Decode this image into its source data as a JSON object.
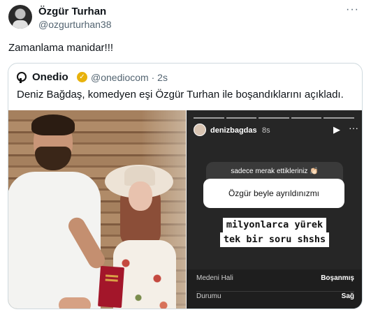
{
  "post": {
    "author_name": "Özgür Turhan",
    "author_handle": "@ozgurturhan38",
    "more_icon": "more-horizontal-icon",
    "text": "Zamanlama manidar!!!"
  },
  "quote": {
    "author_name": "Onedio",
    "author_handle": "@onediocom",
    "time": "2s",
    "verified_color": "#e8b20c",
    "text": "Deniz Bağdaş, komedyen eşi Özgür Turhan ile boşandıklarını açıkladı."
  },
  "story": {
    "username": "denizbagdas",
    "time": "8s",
    "question_prompt": "sadece merak ettikleriniz 👏🏻",
    "question": "Özgür beyle ayrıldınızmı",
    "overlay_line1": "milyonlarca yürek",
    "overlay_line2": "tek bir soru shshs",
    "info": [
      {
        "label": "Medeni Hali",
        "value": "Boşanmış"
      },
      {
        "label": "Durumu",
        "value": "Sağ"
      }
    ]
  }
}
